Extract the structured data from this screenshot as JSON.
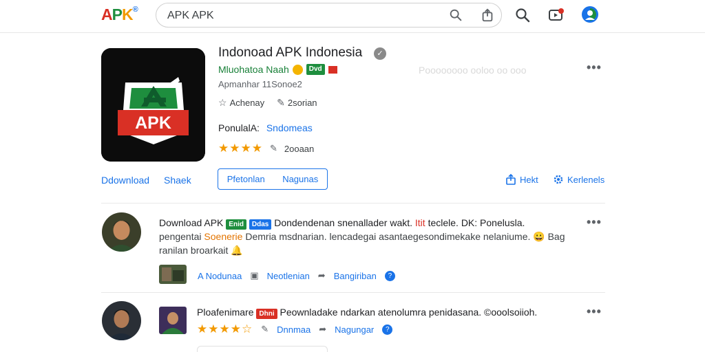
{
  "topbar": {
    "logo": {
      "p1": "A",
      "p2": "P",
      "p3": "K",
      "p4": "®"
    },
    "search_value": "APK APK",
    "icons": [
      "search-icon",
      "share-icon",
      "search-icon",
      "video-icon",
      "account-icon"
    ]
  },
  "app": {
    "icon_text": "APK",
    "title": "Indonoad APK Indonesia",
    "developer": "Mluohatoa Naah",
    "dev_badge": "Dvd",
    "faded_text": "Poooooooo ooloo oo ooo",
    "date": "Apmanhar 11Sonoe2",
    "stat1": "Achenay",
    "stat2": "2sorian",
    "popular_label": "PonulalA:",
    "popular_value": "Sndomeas",
    "rating": 4,
    "rating_count": "2ooaan",
    "more": "•••"
  },
  "actions": {
    "download": "Ddownload",
    "share": "Shaek",
    "btn_left": "Pfetonlan",
    "btn_right": "Nagunas",
    "right1": "Hekt",
    "right2": "Kerlenels"
  },
  "comments": [
    {
      "name": "Download APK",
      "badge1": "Enid",
      "badge2": "Ddas",
      "text1": "Dondendenan snenallader wakt. ",
      "text1_red": "Itit",
      "text1b": " teclele. DK: Ponelusla.",
      "text2a": "pengentai ",
      "text2_orange": "Soenerie",
      "text2b": " Demria msdnarian. lencadegai asantaegesondimekake nelaniume. 😀 Bag",
      "text3": "ranilan broarkait 🔔",
      "act1": "A Nodunaa",
      "act2": "Neotlenian",
      "act3": "Bangiriban",
      "more": "•••"
    },
    {
      "name": "Ploafenimare",
      "badge1": "Dhni",
      "text1": "Peownladake ndarkan atenolumra penidasana. ©ooolsoiioh.",
      "rating": 4.5,
      "act1": "Dnnmaa",
      "act2": "Nagungar",
      "more": "•••"
    }
  ],
  "colors": {
    "accent": "#1a73e8",
    "green": "#1e8e3e",
    "red": "#d93025",
    "star": "#f29900"
  }
}
